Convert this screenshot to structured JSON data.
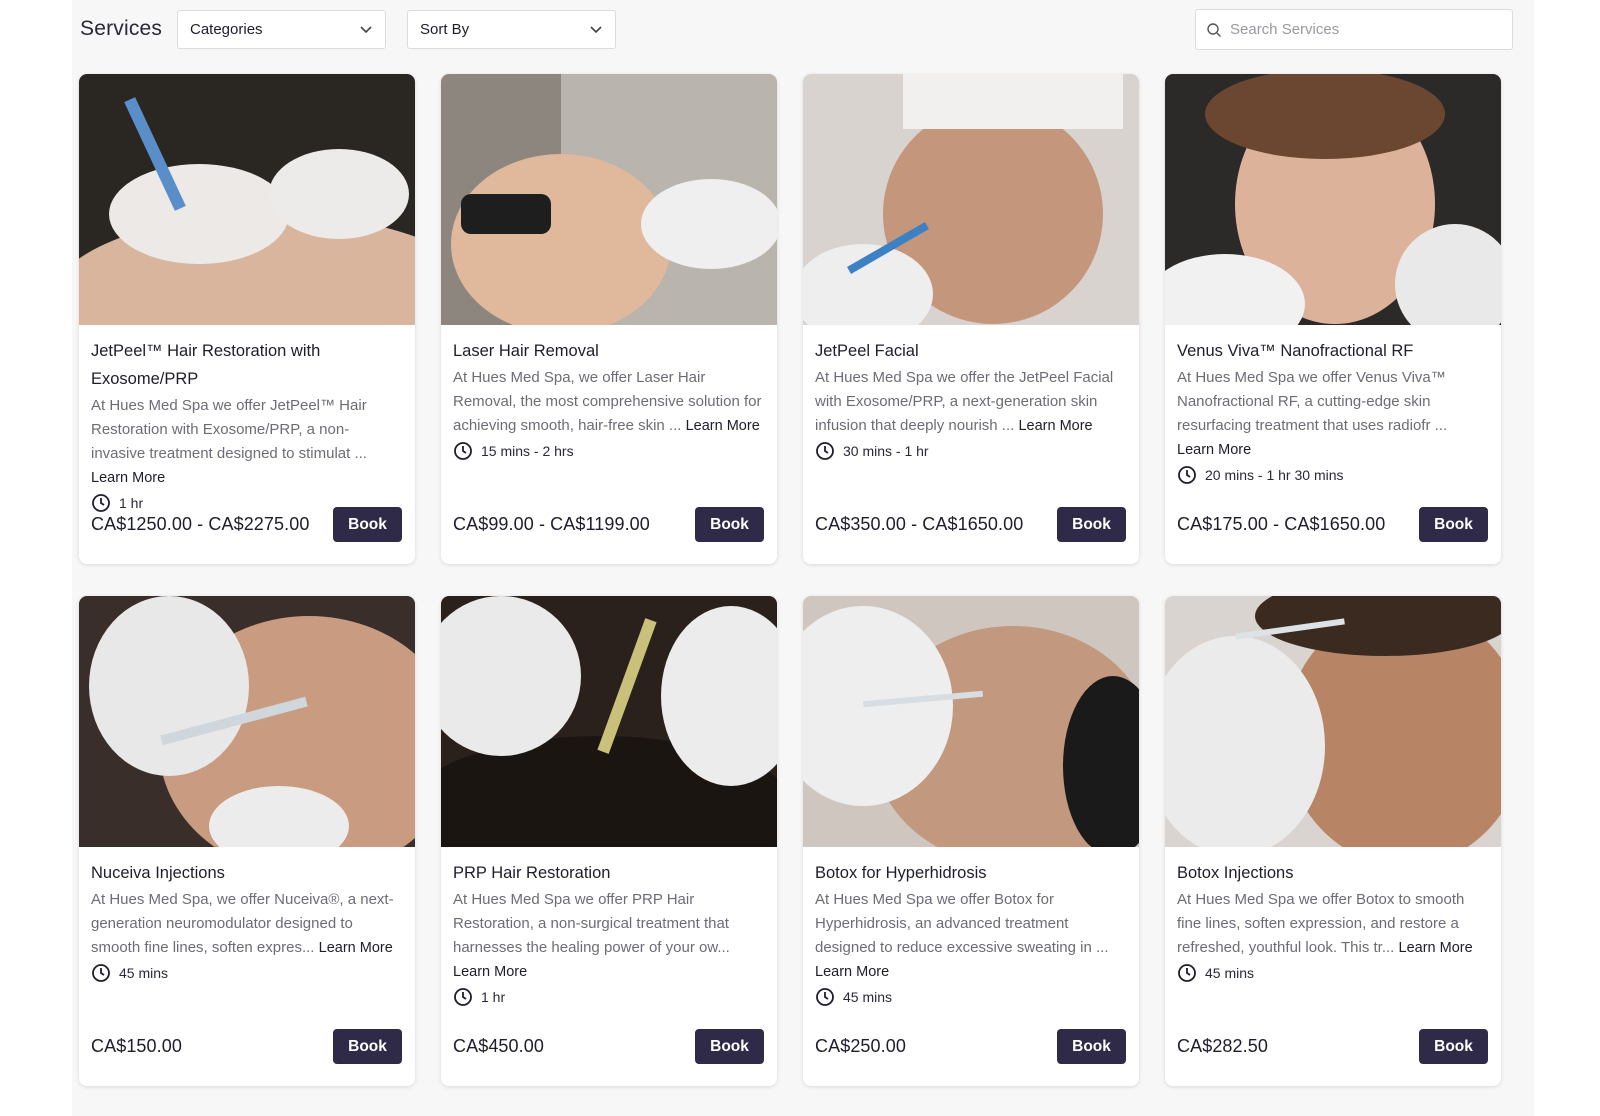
{
  "header": {
    "title": "Services",
    "categories_label": "Categories",
    "sort_label": "Sort By",
    "search_placeholder": "Search Services"
  },
  "learn_more_label": "Learn More",
  "book_label": "Book",
  "services": [
    {
      "title": "JetPeel™ Hair Restoration with Exosome/PRP",
      "description": "At Hues Med Spa we offer JetPeel™ Hair Restoration with Exosome/PRP, a non-invasive treatment designed to stimulat ...",
      "duration": "1 hr",
      "price": "CA$1250.00 - CA$2275.00"
    },
    {
      "title": "Laser Hair Removal",
      "description": "At Hues Med Spa, we offer Laser Hair Removal, the most comprehensive solution for achieving smooth, hair-free skin ...",
      "duration": "15 mins - 2 hrs",
      "price": "CA$99.00 - CA$1199.00"
    },
    {
      "title": "JetPeel Facial",
      "description": "At Hues Med Spa we offer the JetPeel Facial with Exosome/PRP, a next-generation skin infusion that deeply nourish ...",
      "duration": "30 mins - 1 hr",
      "price": "CA$350.00 - CA$1650.00"
    },
    {
      "title": "Venus Viva™ Nanofractional RF",
      "description": "At Hues Med Spa we offer Venus Viva™ Nanofractional RF, a cutting-edge skin resurfacing treatment that uses radiofr ...",
      "duration": "20 mins - 1 hr 30 mins",
      "price": "CA$175.00 - CA$1650.00"
    },
    {
      "title": "Nuceiva Injections",
      "description": "At Hues Med Spa, we offer Nuceiva®, a next-generation neuromodulator designed to smooth fine lines, soften expres...",
      "duration": "45 mins",
      "price": "CA$150.00"
    },
    {
      "title": "PRP Hair Restoration",
      "description": "At Hues Med Spa we offer PRP Hair Restoration, a non-surgical treatment that harnesses the healing power of your ow...",
      "duration": "1 hr",
      "price": "CA$450.00"
    },
    {
      "title": "Botox for Hyperhidrosis",
      "description": "At Hues Med Spa we offer Botox for Hyperhidrosis, an advanced treatment designed to reduce excessive sweating in ...",
      "duration": "45 mins",
      "price": "CA$250.00"
    },
    {
      "title": "Botox Injections",
      "description": "At Hues Med Spa we offer Botox to smooth fine lines, soften expression, and restore a refreshed, youthful look. This tr...",
      "duration": "45 mins",
      "price": "CA$282.50"
    }
  ],
  "colors": {
    "button_bg": "#2e2a48",
    "page_bg": "#f7f7f8",
    "text_primary": "#1f1d2b",
    "text_muted": "#6d6c76"
  }
}
